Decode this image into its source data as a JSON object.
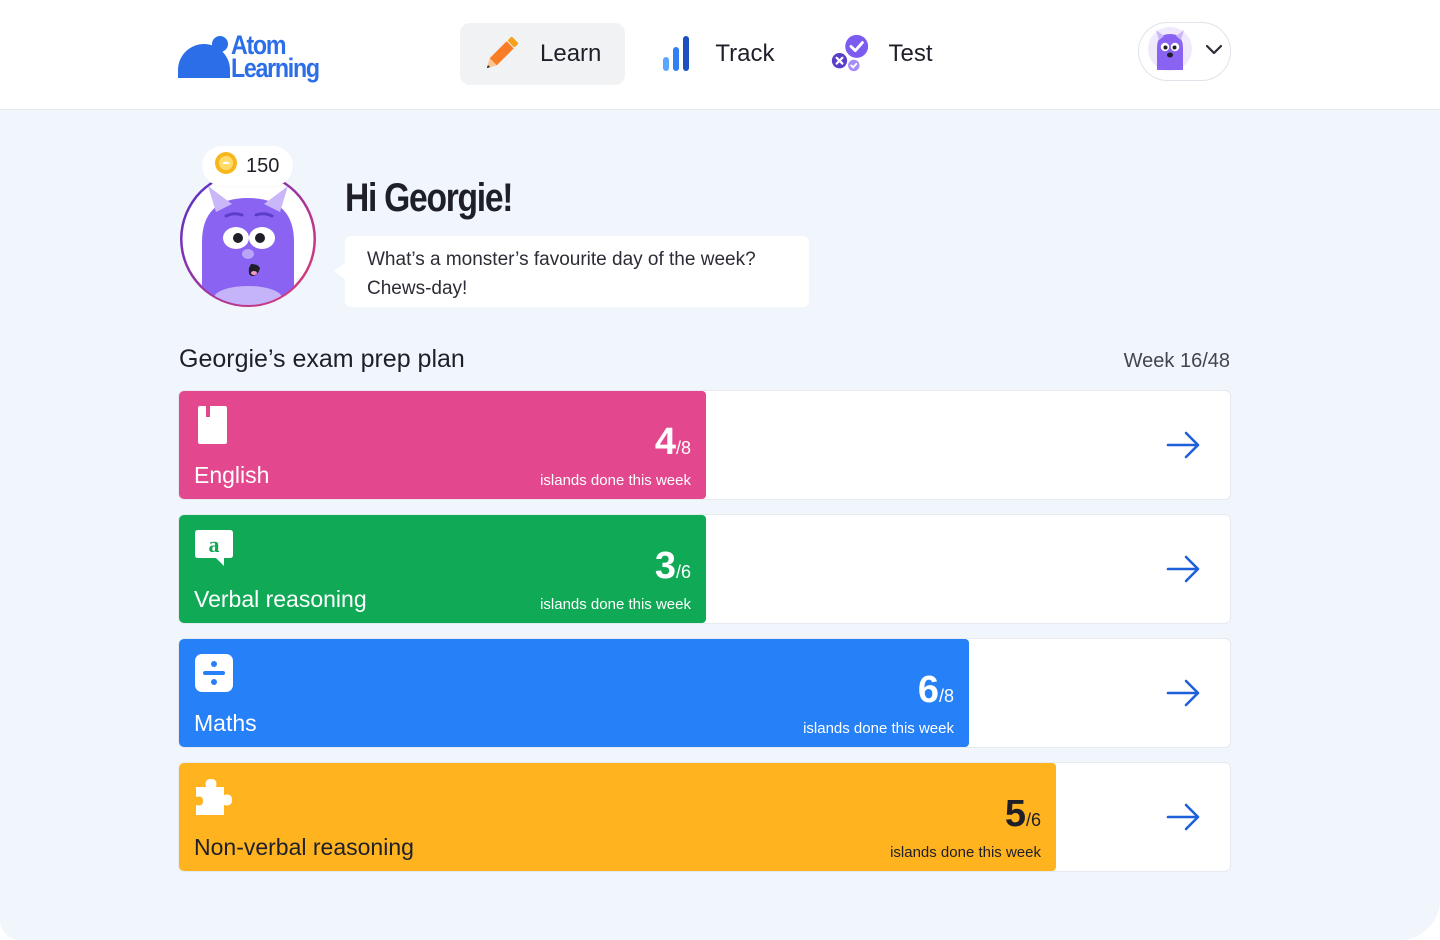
{
  "brand": {
    "line1": "Atom",
    "line2": "Learning",
    "color": "#2b6ee8"
  },
  "nav": [
    {
      "label": "Learn",
      "icon": "pencil-icon",
      "active": true
    },
    {
      "label": "Track",
      "icon": "bar-chart-icon",
      "active": false
    },
    {
      "label": "Test",
      "icon": "test-check-icon",
      "active": false
    }
  ],
  "profile": {
    "icon": "monster-avatar-icon",
    "menu_icon": "chevron-down-icon"
  },
  "greeting": {
    "coins": "150",
    "title": "Hi Georgie!",
    "joke": "What’s a monster’s favourite day of the week? Chews-day!"
  },
  "plan": {
    "title": "Georgie’s exam prep plan",
    "week": "Week 16/48",
    "subjects": [
      {
        "name": "English",
        "done": "4",
        "total": "/8",
        "caption": "islands done this week",
        "progress": 0.5,
        "color": "#e3478d",
        "icon": "book-icon"
      },
      {
        "name": "Verbal reasoning",
        "done": "3",
        "total": "/6",
        "caption": "islands done this week",
        "progress": 0.5,
        "color": "#10a956",
        "icon": "speech-bubble-a-icon"
      },
      {
        "name": "Maths",
        "done": "6",
        "total": "/8",
        "caption": "islands done this week",
        "progress": 0.75,
        "color": "#2680f8",
        "icon": "divide-icon"
      },
      {
        "name": "Non-verbal reasoning",
        "done": "5",
        "total": "/6",
        "caption": "islands done this week",
        "progress": 0.8333,
        "color": "#ffb31f",
        "text_color": "#1f1f29",
        "icon": "puzzle-icon"
      }
    ]
  }
}
